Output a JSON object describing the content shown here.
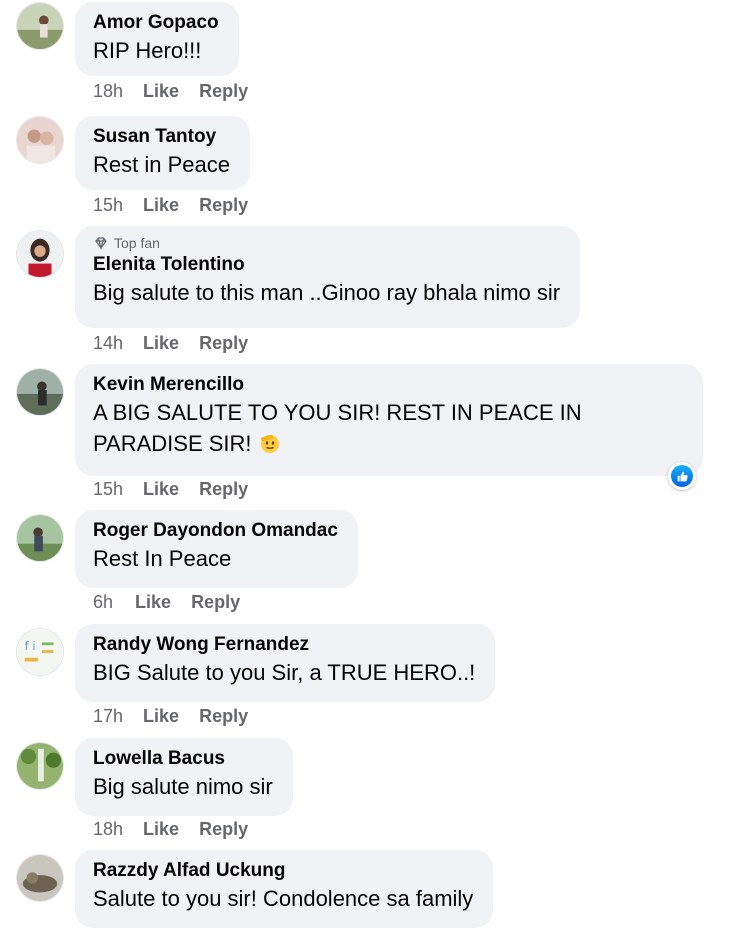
{
  "comments": [
    {
      "author": "Amor Gopaco",
      "text": "RIP Hero!!!",
      "time": "18h",
      "like": "Like",
      "reply": "Reply"
    },
    {
      "author": "Susan Tantoy",
      "text": "Rest in Peace",
      "time": "15h",
      "like": "Like",
      "reply": "Reply"
    },
    {
      "badge": "Top fan",
      "author": "Elenita Tolentino",
      "text": "Big salute to this man ..Ginoo ray bhala nimo sir",
      "time": "14h",
      "like": "Like",
      "reply": "Reply"
    },
    {
      "author": "Kevin Merencillo",
      "text": "A BIG SALUTE TO YOU SIR! REST IN PEACE IN PARADISE SIR!",
      "emoji": "saluting-face-emoji",
      "reaction": "like-reaction-icon",
      "time": "15h",
      "like": "Like",
      "reply": "Reply"
    },
    {
      "author": "Roger Dayondon Omandac",
      "text": "Rest In Peace",
      "time": "6h",
      "like": "Like",
      "reply": "Reply"
    },
    {
      "author": "Randy Wong Fernandez",
      "text": "BIG Salute to you Sir, a TRUE HERO..!",
      "time": "17h",
      "like": "Like",
      "reply": "Reply"
    },
    {
      "author": "Lowella Bacus",
      "text": "Big salute nimo sir",
      "time": "18h",
      "like": "Like",
      "reply": "Reply"
    },
    {
      "author": "Razzdy Alfad Uckung",
      "text": "Salute to you sir! Condolence sa family"
    }
  ],
  "colors": {
    "bubble": "#f0f2f5",
    "secondary_text": "#65676b",
    "like_blue": "#1877f2"
  }
}
